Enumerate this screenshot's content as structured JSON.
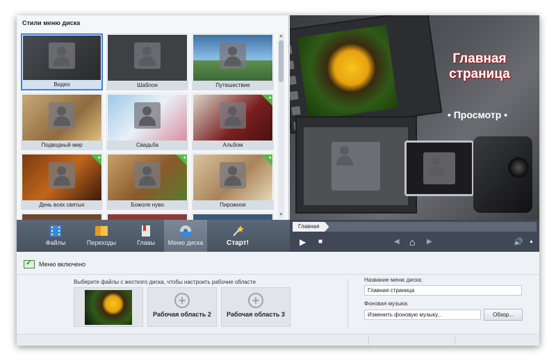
{
  "styles_panel": {
    "title": "Стили меню диска",
    "thumbnails": [
      {
        "label": "Видео",
        "selected": true,
        "badge": false
      },
      {
        "label": "Шаблон",
        "selected": false,
        "badge": false
      },
      {
        "label": "Путешествие",
        "selected": false,
        "badge": false
      },
      {
        "label": "Подводный мир",
        "selected": false,
        "badge": false
      },
      {
        "label": "Свадьба",
        "selected": false,
        "badge": false
      },
      {
        "label": "Альбом",
        "selected": false,
        "badge": true
      },
      {
        "label": "День всех святых",
        "selected": false,
        "badge": true
      },
      {
        "label": "Божоле нуво",
        "selected": false,
        "badge": true
      },
      {
        "label": "Пирожное",
        "selected": false,
        "badge": true
      }
    ]
  },
  "preview": {
    "title": "Главная страница",
    "view_label": "• Просмотр •"
  },
  "toolbar": {
    "items": [
      {
        "label": "Файлы",
        "icon": "film-icon"
      },
      {
        "label": "Переходы",
        "icon": "transitions-icon"
      },
      {
        "label": "Главы",
        "icon": "bookmark-icon"
      },
      {
        "label": "Меню диска",
        "icon": "disc-menu-icon",
        "active": true
      },
      {
        "label": "Старт!",
        "icon": "magic-wand-icon"
      }
    ]
  },
  "player": {
    "chapter_tab": "Главная",
    "play_icon": "▶",
    "stop_icon": "■",
    "prev_icon": "◀",
    "home_icon": "⌂",
    "next_icon": "▶",
    "volume_icon": "🔊",
    "volume_arrow": "▲"
  },
  "menu_enabled_label": "Меню включено",
  "areas": {
    "choose_label": "Выберите файлы с жесткого диска, чтобы настроить рабочие области",
    "area2_label": "Рабочая область 2",
    "area3_label": "Рабочая область 3"
  },
  "settings": {
    "name_label": "Название меню диска:",
    "name_value": "Главная страница",
    "music_label": "Фоновая музыка:",
    "music_value": "Изменить фоновую музыку...",
    "browse_label": "Обзор..."
  },
  "colors": {
    "accent": "#3c82d8",
    "toolbar": "#4f5a68",
    "badge": "#54b848"
  }
}
